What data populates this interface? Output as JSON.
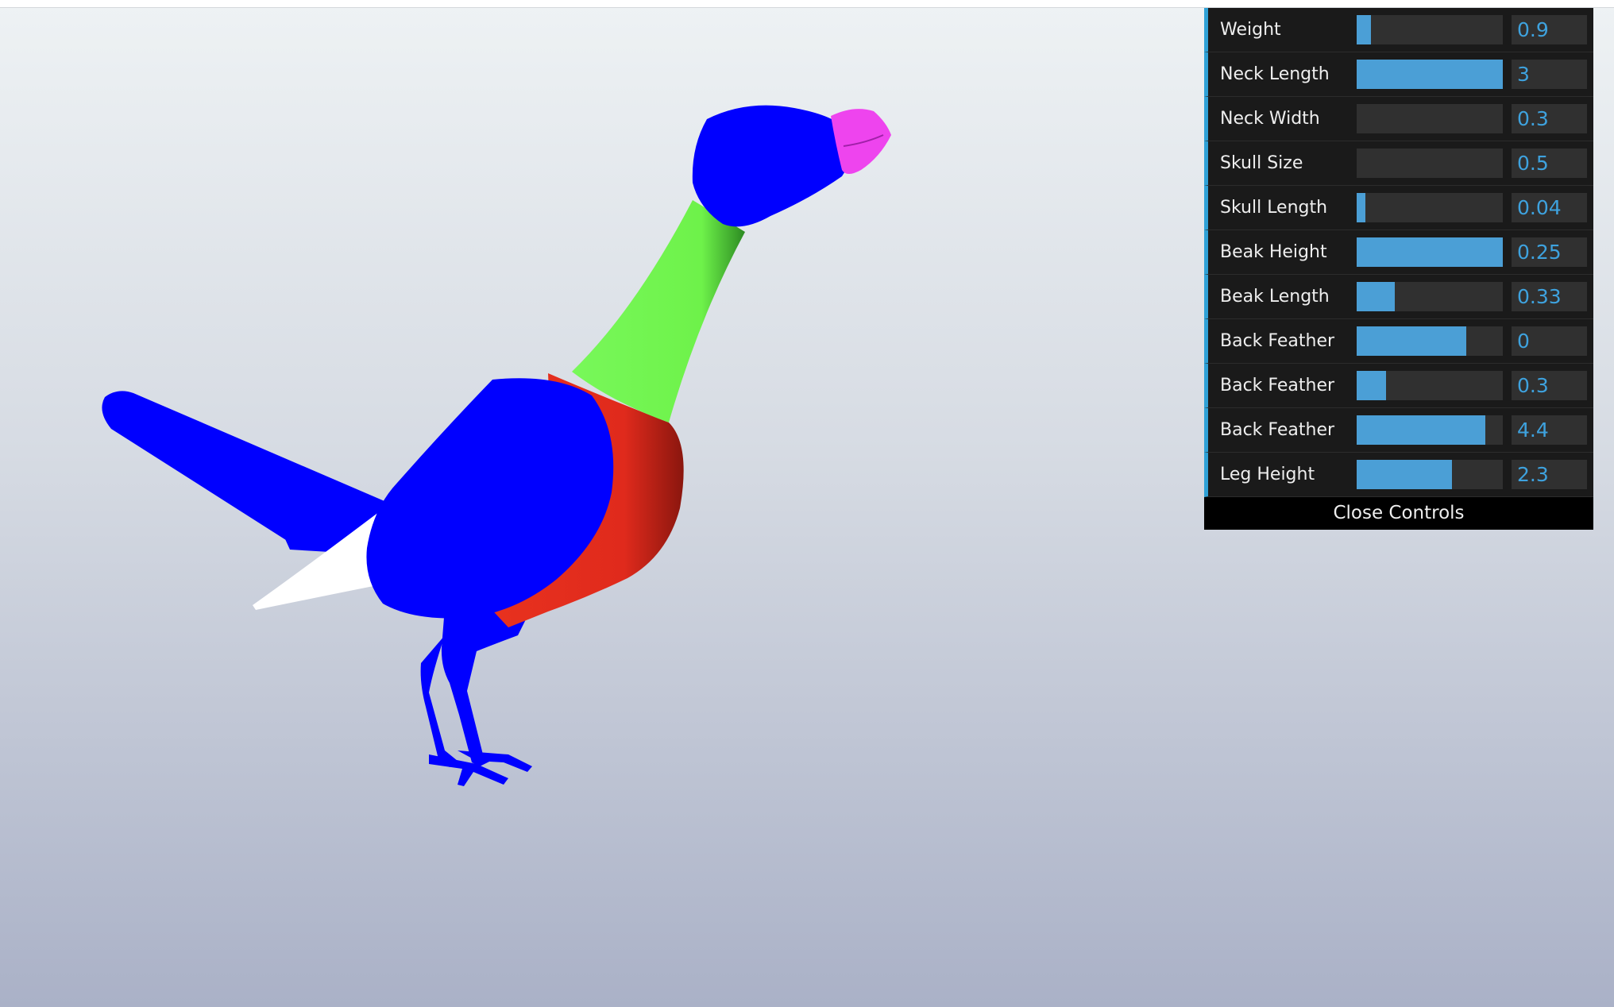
{
  "scene": {
    "colors": {
      "head": "#0000ff",
      "beak": "#ee44ee",
      "neck": "#6ef24a",
      "chest": "#e02a1c",
      "body": "#0000ff",
      "tail": "#0000ff",
      "tail_white": "#ffffff",
      "legs": "#0000ff"
    }
  },
  "controls": {
    "accent": "#2fa1d6",
    "items": [
      {
        "label": "Weight",
        "value": "0.9",
        "fill": 0.1
      },
      {
        "label": "Neck Length",
        "value": "3",
        "fill": 1.0
      },
      {
        "label": "Neck Width",
        "value": "0.3",
        "fill": 0.0
      },
      {
        "label": "Skull Size",
        "value": "0.5",
        "fill": 0.0
      },
      {
        "label": "Skull Length",
        "value": "0.04",
        "fill": 0.06
      },
      {
        "label": "Beak Height",
        "value": "0.25",
        "fill": 1.0
      },
      {
        "label": "Beak Length",
        "value": "0.33",
        "fill": 0.26
      },
      {
        "label": "Back Feather",
        "value": "0",
        "fill": 0.75
      },
      {
        "label": "Back Feather",
        "value": "0.3",
        "fill": 0.2
      },
      {
        "label": "Back Feather",
        "value": "4.4",
        "fill": 0.88
      },
      {
        "label": "Leg Height",
        "value": "2.3",
        "fill": 0.65
      }
    ],
    "close_label": "Close Controls"
  }
}
